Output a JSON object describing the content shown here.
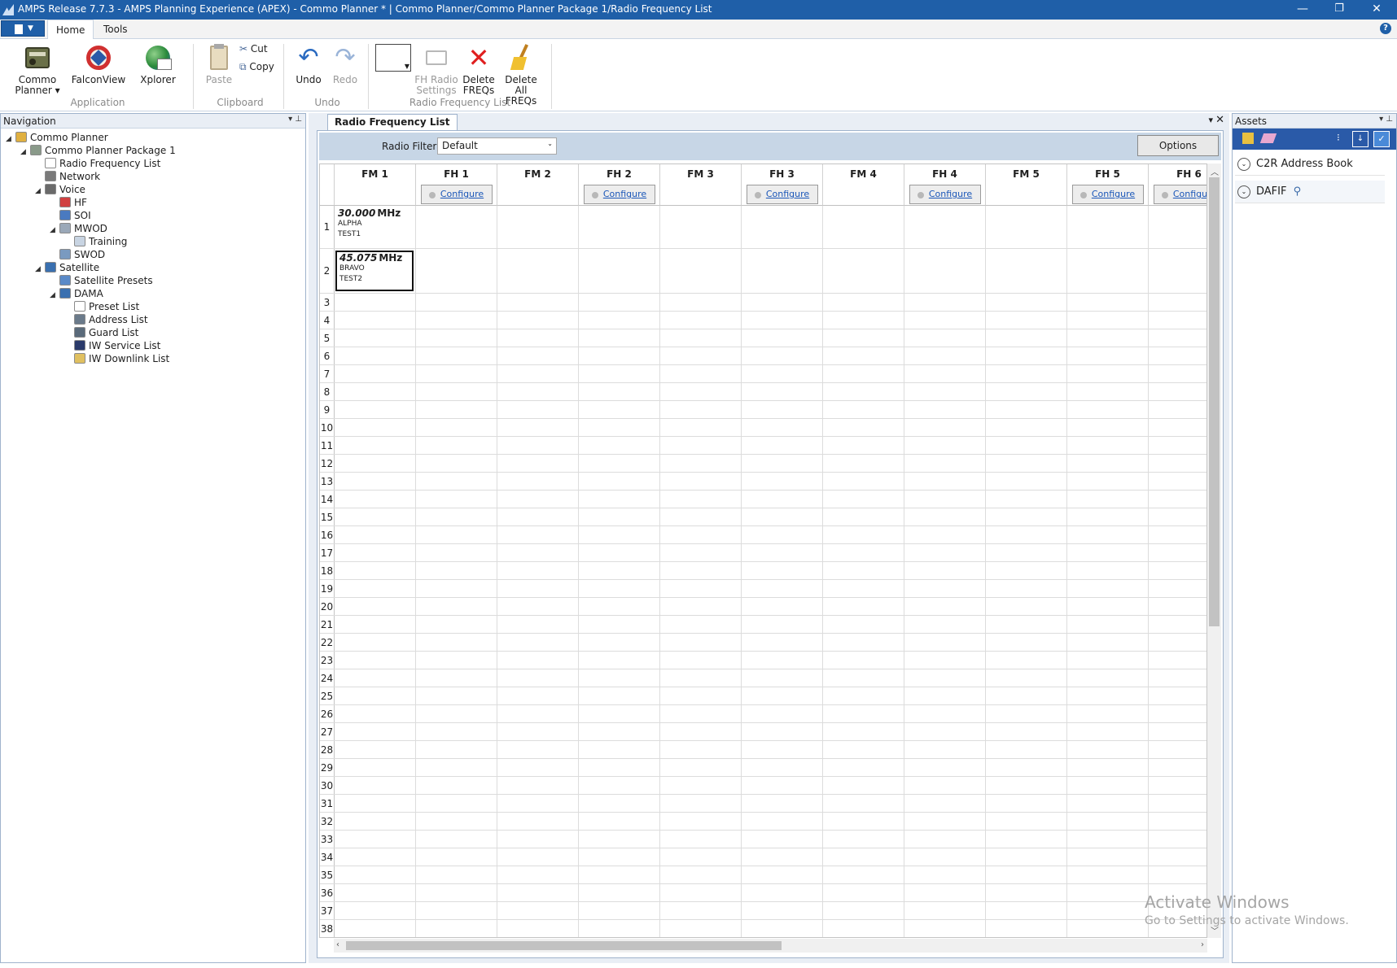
{
  "window": {
    "title": "AMPS Release 7.7.3 - AMPS Planning Experience (APEX) - Commo Planner *   |   Commo Planner/Commo Planner Package 1/Radio Frequency List",
    "minimize": "—",
    "restore": "❐",
    "close": "✕"
  },
  "menu": {
    "tabs": [
      "Home",
      "Tools"
    ],
    "help": "?"
  },
  "ribbon": {
    "application": {
      "commo_planner_line1": "Commo",
      "commo_planner_line2": "Planner ▾",
      "falconview": "FalconView",
      "xplorer": "Xplorer",
      "group": "Application"
    },
    "clipboard": {
      "paste": "Paste",
      "cut": "Cut",
      "copy": "Copy",
      "group": "Clipboard"
    },
    "undo": {
      "undo": "Undo",
      "redo": "Redo",
      "group": "Undo"
    },
    "rfl": {
      "fh_line1": "FH Radio",
      "fh_line2": "Settings",
      "del_line1": "Delete",
      "del_line2": "FREQs",
      "delall_line1": "Delete All",
      "delall_line2": "FREQs",
      "group": "Radio Frequency List"
    }
  },
  "navigation": {
    "title": "Navigation",
    "items": [
      {
        "label": "Commo Planner",
        "icon": "commo-planner-icon",
        "color": "#e0b040"
      },
      {
        "label": "Commo Planner Package 1",
        "icon": "package-icon",
        "color": "#8a9a8a"
      },
      {
        "label": "Radio Frequency List",
        "icon": "list-icon",
        "color": "#ffffff"
      },
      {
        "label": "Network",
        "icon": "network-icon",
        "color": "#7a7a7a"
      },
      {
        "label": "Voice",
        "icon": "voice-icon",
        "color": "#6a6a6a"
      },
      {
        "label": "HF",
        "icon": "hf-icon",
        "color": "#d04040"
      },
      {
        "label": "SOI",
        "icon": "soi-icon",
        "color": "#4a7ac0"
      },
      {
        "label": "MWOD",
        "icon": "mwod-icon",
        "color": "#9aa8b8"
      },
      {
        "label": "Training",
        "icon": "training-icon",
        "color": "#c8d4e2"
      },
      {
        "label": "SWOD",
        "icon": "swod-icon",
        "color": "#7a9ac0"
      },
      {
        "label": "Satellite",
        "icon": "satellite-icon",
        "color": "#3a70b0"
      },
      {
        "label": "Satellite Presets",
        "icon": "satellite-presets-icon",
        "color": "#5a8ac8"
      },
      {
        "label": "DAMA",
        "icon": "dama-icon",
        "color": "#3a70b0"
      },
      {
        "label": "Preset List",
        "icon": "preset-list-icon",
        "color": "#ffffff"
      },
      {
        "label": "Address List",
        "icon": "address-list-icon",
        "color": "#6a7a8a"
      },
      {
        "label": "Guard List",
        "icon": "guard-list-icon",
        "color": "#5a6a7a"
      },
      {
        "label": "IW Service List",
        "icon": "iw-service-icon",
        "color": "#2a3a6a"
      },
      {
        "label": "IW Downlink List",
        "icon": "iw-downlink-icon",
        "color": "#e0c060"
      }
    ]
  },
  "document": {
    "tab": "Radio Frequency List",
    "filter_label": "Radio Filter:",
    "filter_value": "Default",
    "options": "Options",
    "columns": [
      {
        "name": "FM 1",
        "configure": ""
      },
      {
        "name": "FH 1",
        "configure": "Configure"
      },
      {
        "name": "FM 2",
        "configure": ""
      },
      {
        "name": "FH 2",
        "configure": "Configure"
      },
      {
        "name": "FM 3",
        "configure": ""
      },
      {
        "name": "FH 3",
        "configure": "Configure"
      },
      {
        "name": "FM 4",
        "configure": ""
      },
      {
        "name": "FH 4",
        "configure": "Configure"
      },
      {
        "name": "FM 5",
        "configure": ""
      },
      {
        "name": "FH 5",
        "configure": "Configure"
      },
      {
        "name": "FH 6",
        "configure": "Configure"
      }
    ],
    "rows": [
      "1",
      "2",
      "3",
      "4",
      "5",
      "6",
      "7",
      "8",
      "9",
      "10",
      "11",
      "12",
      "13",
      "14",
      "15",
      "16",
      "17",
      "18",
      "19",
      "20",
      "21",
      "22",
      "23",
      "24",
      "25",
      "26",
      "27",
      "28",
      "29",
      "30",
      "31",
      "32",
      "33",
      "34",
      "35",
      "36",
      "37",
      "38"
    ],
    "frequencies": [
      {
        "value": "30.000",
        "unit": "MHz",
        "line1": "ALPHA",
        "line2": "TEST1"
      },
      {
        "value": "45.075",
        "unit": "MHz",
        "line1": "BRAVO",
        "line2": "TEST2"
      }
    ]
  },
  "assets": {
    "title": "Assets",
    "items": [
      "C2R Address Book",
      "DAFIF"
    ]
  },
  "watermark": {
    "line1": "Activate Windows",
    "line2": "Go to Settings to activate Windows."
  }
}
